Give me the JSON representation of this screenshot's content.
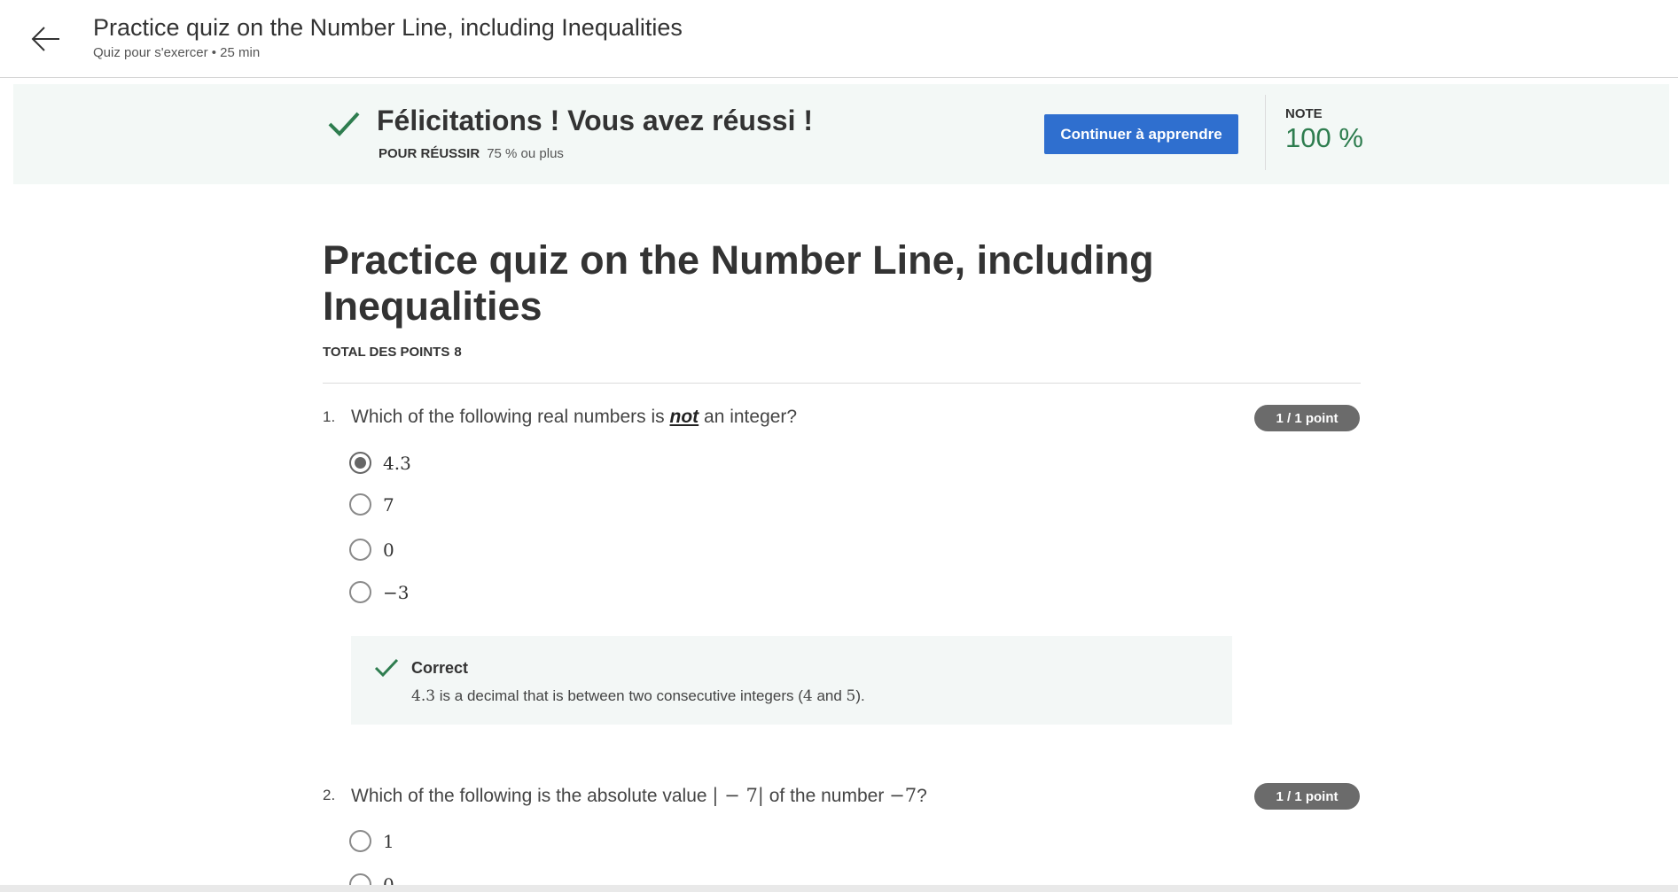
{
  "header": {
    "title": "Practice quiz on the Number Line, including Inequalities",
    "subtitle": "Quiz pour s'exercer • 25 min"
  },
  "result": {
    "message": "Félicitations ! Vous avez réussi !",
    "pass_label": "POUR RÉUSSIR",
    "pass_value": "75 % ou plus",
    "continue_label": "Continuer à apprendre",
    "grade_label": "NOTE",
    "grade_value": "100 %"
  },
  "quiz": {
    "title": "Practice quiz on the Number Line, including Inequalities",
    "total_points_label": "TOTAL DES POINTS",
    "total_points_value": "8"
  },
  "questions": [
    {
      "number": "1.",
      "text_before": "Which of the following real numbers is",
      "text_emphasis": "not",
      "text_after": "an integer?",
      "points": "1 / 1 point",
      "options": [
        "4.3",
        "7",
        "0",
        "−3"
      ],
      "selected_index": 0,
      "feedback": {
        "title": "Correct",
        "math_value": "4.3",
        "text_a": "is a decimal that is between two consecutive integers (",
        "math_a": "4",
        "text_b": "and",
        "math_b": "5",
        "text_c": ")."
      }
    },
    {
      "number": "2.",
      "text_before": "Which of the following is the absolute value",
      "math_expr": "| − 7|",
      "text_middle": "of the number",
      "math_number": "−7",
      "text_after": "?",
      "points": "1 / 1 point",
      "options": [
        "1",
        "0"
      ]
    }
  ],
  "colors": {
    "primary_button": "#2f6fcf",
    "success_green": "#2e7d4f",
    "banner_bg": "#f3f8f6",
    "badge_bg": "#6b6b6b"
  },
  "icons": {
    "back": "arrow-left-icon",
    "success": "checkmark-icon"
  }
}
